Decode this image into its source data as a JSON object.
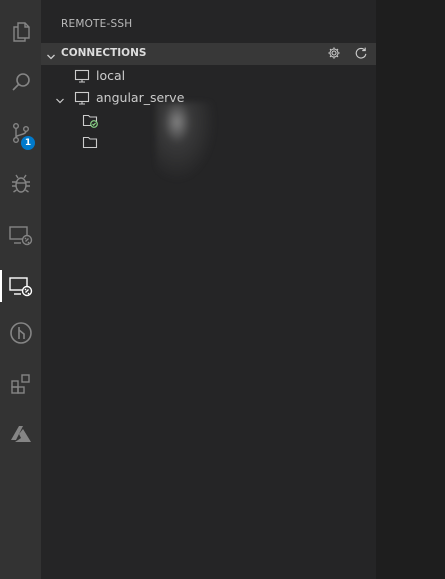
{
  "colors": {
    "activity_bar_bg": "#333333",
    "sidebar_bg": "#252526",
    "editor_bg": "#1e1e1e",
    "badge_bg": "#007acc",
    "connected_green": "#89d185"
  },
  "activity_bar": {
    "items": [
      {
        "name": "explorer",
        "icon": "files-icon"
      },
      {
        "name": "search",
        "icon": "search-icon"
      },
      {
        "name": "source-control",
        "icon": "source-control-icon",
        "badge": "1"
      },
      {
        "name": "debug",
        "icon": "debug-icon"
      },
      {
        "name": "remote-explorer",
        "icon": "remote-explorer-icon"
      },
      {
        "name": "remote-ssh",
        "icon": "remote-ssh-icon",
        "active": true
      },
      {
        "name": "git-graph",
        "icon": "git-icon"
      },
      {
        "name": "extensions",
        "icon": "extensions-icon"
      },
      {
        "name": "azure",
        "icon": "azure-icon"
      }
    ]
  },
  "sidebar": {
    "title": "REMOTE-SSH",
    "section": {
      "title": "CONNECTIONS",
      "actions": [
        {
          "name": "configure",
          "icon": "gear-icon"
        },
        {
          "name": "refresh",
          "icon": "refresh-icon"
        }
      ]
    },
    "tree": [
      {
        "label": "local",
        "icon": "monitor-icon",
        "level": 0,
        "collapsible": false
      },
      {
        "label": "angular_serve",
        "icon": "monitor-icon",
        "level": 0,
        "collapsible": true,
        "expanded": true
      },
      {
        "label": "",
        "icon": "folder-connected-icon",
        "level": 1
      },
      {
        "label": "",
        "icon": "folder-icon",
        "level": 1
      }
    ]
  }
}
